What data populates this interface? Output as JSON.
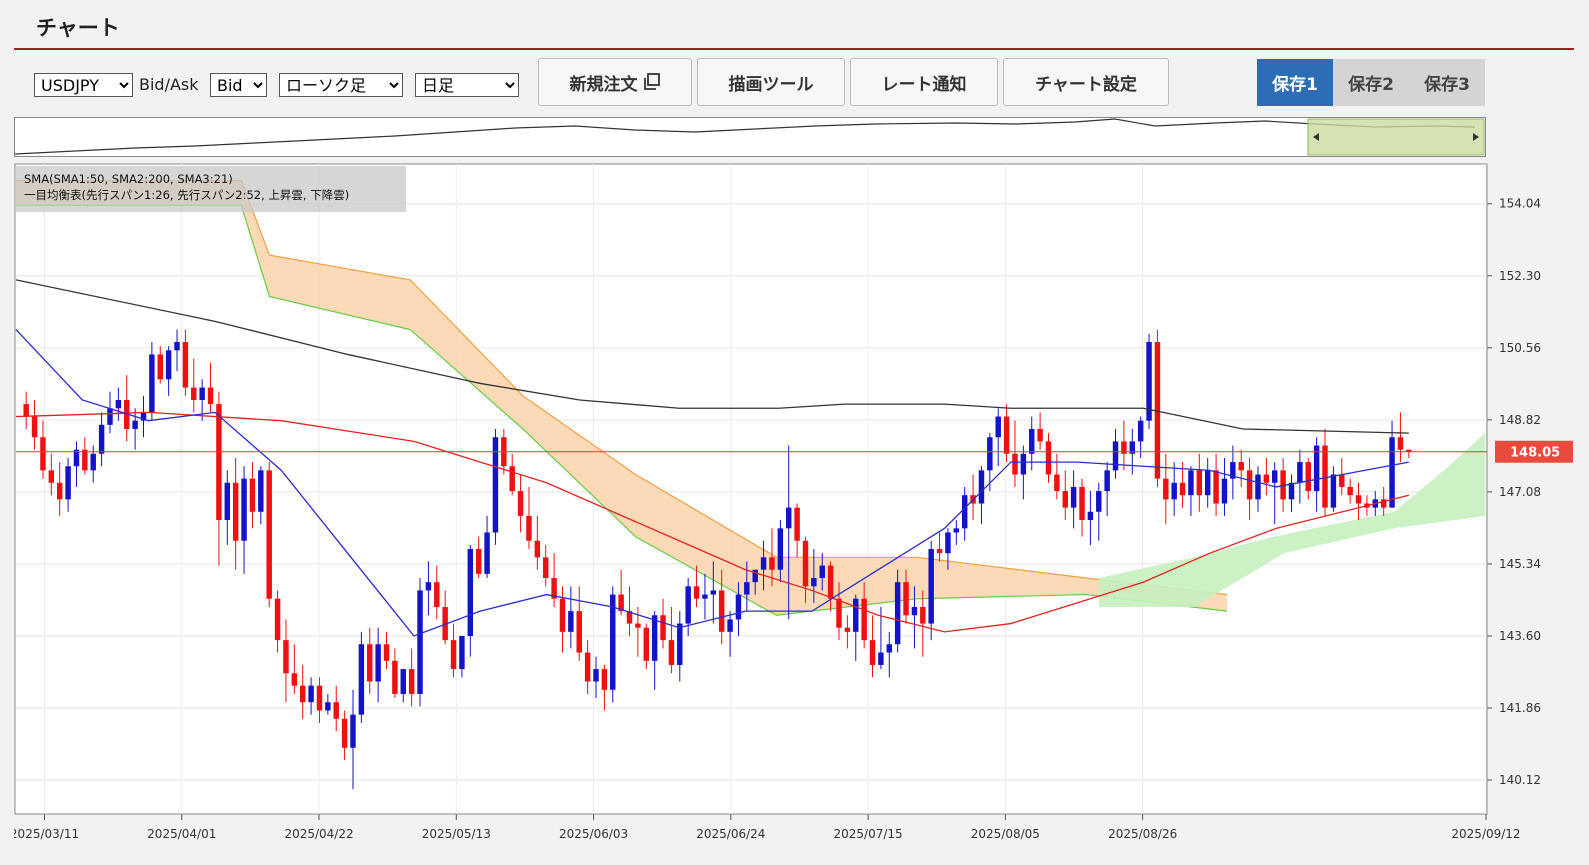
{
  "header": {
    "title": "チャート"
  },
  "toolbar": {
    "symbol": "USDJPY",
    "bidask_label": "Bid/Ask",
    "bidask_value": "Bid",
    "chart_type": "ローソク足",
    "period": "日足",
    "new_order": "新規注文",
    "drawing_tools": "描画ツール",
    "rate_alert": "レート通知",
    "chart_settings": "チャート設定"
  },
  "save": {
    "save1": "保存1",
    "save2": "保存2",
    "save3": "保存3"
  },
  "legend": {
    "sma": "SMA(SMA1:50, SMA2:200, SMA3:21)",
    "ichimoku": "一目均衡表(先行スパン1:26, 先行スパン2:52, 上昇雲, 下降雲)"
  },
  "colors": {
    "up": "#1313c8",
    "down": "#ee1111",
    "sma1": "#e52020",
    "sma2": "#333333",
    "sma3": "#2a2ad0",
    "cloud_bear": "#fbd3ab",
    "cloud_bull": "#c5f0bf",
    "span1": "#66cc44",
    "span2": "#f0a040",
    "accent": "#2d6db5"
  },
  "chart_data": {
    "type": "candlestick",
    "current_price": "148.05",
    "ylim": [
      139.3,
      155.0
    ],
    "y_ticks": [
      "154.04",
      "152.30",
      "150.56",
      "148.82",
      "147.08",
      "145.34",
      "143.60",
      "141.86",
      "140.12"
    ],
    "x_ticks": [
      "2025/03/11",
      "2025/04/01",
      "2025/04/22",
      "2025/05/13",
      "2025/06/03",
      "2025/06/24",
      "2025/07/15",
      "2025/08/05",
      "2025/08/26",
      "2025/09/12"
    ],
    "candles": [
      [
        149.2,
        149.5,
        148.6,
        148.9
      ],
      [
        148.9,
        149.3,
        148.1,
        148.4
      ],
      [
        148.4,
        148.8,
        147.4,
        147.6
      ],
      [
        147.6,
        148.0,
        147.0,
        147.3
      ],
      [
        147.3,
        147.8,
        146.5,
        146.9
      ],
      [
        146.9,
        147.9,
        146.6,
        147.7
      ],
      [
        147.7,
        148.3,
        147.2,
        148.1
      ],
      [
        148.1,
        148.4,
        147.5,
        147.6
      ],
      [
        147.6,
        148.2,
        147.3,
        148.0
      ],
      [
        148.0,
        149.0,
        147.7,
        148.7
      ],
      [
        148.7,
        149.5,
        148.5,
        149.1
      ],
      [
        149.1,
        149.6,
        148.8,
        149.3
      ],
      [
        149.3,
        149.9,
        148.3,
        148.6
      ],
      [
        148.6,
        149.1,
        148.1,
        148.8
      ],
      [
        148.8,
        149.4,
        148.4,
        149.0
      ],
      [
        149.0,
        150.7,
        148.8,
        150.4
      ],
      [
        150.4,
        150.6,
        149.7,
        149.8
      ],
      [
        149.8,
        150.6,
        149.4,
        150.5
      ],
      [
        150.5,
        151.0,
        150.0,
        150.7
      ],
      [
        150.7,
        151.0,
        149.4,
        149.6
      ],
      [
        149.6,
        150.3,
        149.0,
        149.3
      ],
      [
        149.3,
        149.8,
        148.8,
        149.6
      ],
      [
        149.6,
        150.2,
        149.0,
        149.2
      ],
      [
        149.2,
        149.5,
        145.3,
        146.4
      ],
      [
        146.4,
        147.6,
        145.8,
        147.3
      ],
      [
        147.3,
        147.9,
        145.2,
        145.9
      ],
      [
        145.9,
        147.7,
        145.1,
        147.4
      ],
      [
        147.4,
        147.8,
        146.2,
        146.6
      ],
      [
        146.6,
        147.7,
        146.3,
        147.6
      ],
      [
        147.6,
        147.8,
        144.3,
        144.5
      ],
      [
        144.5,
        144.7,
        143.2,
        143.5
      ],
      [
        143.5,
        144.0,
        142.0,
        142.7
      ],
      [
        142.7,
        143.4,
        142.2,
        142.4
      ],
      [
        142.4,
        142.9,
        141.6,
        142.0
      ],
      [
        142.0,
        142.6,
        141.7,
        142.4
      ],
      [
        142.4,
        142.6,
        141.5,
        141.8
      ],
      [
        141.8,
        142.2,
        141.7,
        142.0
      ],
      [
        142.0,
        142.4,
        141.3,
        141.6
      ],
      [
        141.6,
        141.8,
        140.6,
        140.9
      ],
      [
        140.9,
        142.3,
        139.9,
        141.7
      ],
      [
        141.7,
        143.7,
        141.5,
        143.4
      ],
      [
        143.4,
        143.8,
        142.2,
        142.5
      ],
      [
        142.5,
        143.8,
        142.0,
        143.4
      ],
      [
        143.4,
        143.7,
        142.8,
        143.0
      ],
      [
        143.0,
        143.3,
        142.1,
        142.2
      ],
      [
        142.2,
        142.8,
        142.0,
        142.8
      ],
      [
        142.8,
        143.3,
        141.9,
        142.2
      ],
      [
        142.2,
        145.0,
        141.9,
        144.7
      ],
      [
        144.7,
        145.4,
        144.1,
        144.9
      ],
      [
        144.9,
        145.3,
        144.0,
        144.3
      ],
      [
        144.3,
        144.7,
        143.4,
        143.5
      ],
      [
        143.5,
        143.9,
        142.6,
        142.8
      ],
      [
        142.8,
        143.5,
        142.6,
        143.6
      ],
      [
        143.6,
        145.8,
        143.1,
        145.7
      ],
      [
        145.7,
        146.0,
        145.0,
        145.1
      ],
      [
        145.1,
        146.5,
        145.0,
        146.1
      ],
      [
        146.1,
        148.6,
        145.8,
        148.4
      ],
      [
        148.4,
        148.6,
        147.5,
        147.7
      ],
      [
        147.7,
        148.0,
        147.0,
        147.1
      ],
      [
        147.1,
        147.5,
        146.1,
        146.5
      ],
      [
        146.5,
        147.2,
        145.7,
        145.9
      ],
      [
        145.9,
        146.5,
        145.2,
        145.5
      ],
      [
        145.5,
        145.8,
        144.8,
        145.0
      ],
      [
        145.0,
        145.6,
        144.3,
        144.5
      ],
      [
        144.5,
        144.8,
        143.2,
        143.7
      ],
      [
        143.7,
        144.8,
        143.3,
        144.2
      ],
      [
        144.2,
        144.8,
        143.0,
        143.2
      ],
      [
        143.2,
        143.5,
        142.2,
        142.5
      ],
      [
        142.5,
        143.1,
        142.1,
        142.8
      ],
      [
        142.8,
        142.9,
        141.8,
        142.3
      ],
      [
        142.3,
        144.8,
        142.0,
        144.6
      ],
      [
        144.6,
        145.2,
        144.1,
        144.2
      ],
      [
        144.2,
        144.8,
        143.6,
        143.9
      ],
      [
        143.9,
        144.3,
        143.1,
        143.8
      ],
      [
        143.8,
        143.9,
        142.8,
        143.0
      ],
      [
        143.0,
        144.2,
        142.3,
        144.1
      ],
      [
        144.1,
        144.5,
        143.3,
        143.5
      ],
      [
        143.5,
        144.3,
        142.7,
        142.9
      ],
      [
        142.9,
        144.2,
        142.5,
        143.9
      ],
      [
        143.9,
        145.0,
        143.6,
        144.8
      ],
      [
        144.8,
        145.3,
        144.3,
        144.5
      ],
      [
        144.5,
        145.1,
        144.0,
        144.6
      ],
      [
        144.6,
        145.4,
        143.9,
        144.7
      ],
      [
        144.7,
        145.2,
        143.4,
        143.7
      ],
      [
        143.7,
        144.2,
        143.1,
        144.0
      ],
      [
        144.0,
        144.9,
        143.6,
        144.6
      ],
      [
        144.6,
        145.4,
        144.2,
        144.9
      ],
      [
        144.9,
        145.2,
        144.6,
        145.2
      ],
      [
        145.2,
        145.9,
        144.7,
        145.5
      ],
      [
        145.5,
        146.2,
        144.8,
        145.2
      ],
      [
        145.2,
        146.4,
        144.9,
        146.2
      ],
      [
        146.2,
        148.2,
        144.0,
        146.7
      ],
      [
        146.7,
        146.8,
        145.5,
        145.9
      ],
      [
        145.9,
        146.0,
        144.4,
        144.8
      ],
      [
        144.8,
        145.7,
        144.4,
        145.0
      ],
      [
        145.0,
        145.6,
        144.7,
        145.3
      ],
      [
        145.3,
        145.4,
        144.2,
        144.5
      ],
      [
        144.5,
        144.9,
        143.5,
        143.8
      ],
      [
        143.8,
        144.1,
        143.3,
        143.7
      ],
      [
        143.7,
        144.6,
        143.0,
        144.5
      ],
      [
        144.5,
        144.9,
        143.3,
        143.5
      ],
      [
        143.5,
        144.1,
        142.6,
        142.9
      ],
      [
        142.9,
        144.3,
        142.8,
        143.2
      ],
      [
        143.2,
        143.7,
        142.6,
        143.4
      ],
      [
        143.4,
        145.2,
        143.2,
        144.9
      ],
      [
        144.9,
        145.2,
        143.9,
        144.1
      ],
      [
        144.1,
        144.8,
        143.3,
        144.3
      ],
      [
        144.3,
        144.7,
        143.1,
        143.9
      ],
      [
        143.9,
        145.9,
        143.5,
        145.7
      ],
      [
        145.7,
        146.1,
        145.4,
        145.6
      ],
      [
        145.6,
        146.2,
        145.2,
        146.1
      ],
      [
        146.1,
        146.4,
        145.8,
        146.2
      ],
      [
        146.2,
        147.2,
        145.9,
        147.0
      ],
      [
        147.0,
        147.5,
        146.4,
        146.8
      ],
      [
        146.8,
        147.7,
        146.3,
        147.6
      ],
      [
        147.6,
        148.5,
        147.1,
        148.4
      ],
      [
        148.4,
        149.1,
        147.7,
        148.9
      ],
      [
        148.9,
        149.2,
        147.8,
        148.0
      ],
      [
        148.0,
        148.8,
        147.2,
        147.5
      ],
      [
        147.5,
        148.2,
        146.9,
        148.0
      ],
      [
        148.0,
        148.9,
        147.6,
        148.6
      ],
      [
        148.6,
        149.0,
        148.1,
        148.3
      ],
      [
        148.3,
        148.5,
        147.3,
        147.5
      ],
      [
        147.5,
        148.0,
        146.9,
        147.1
      ],
      [
        147.1,
        147.6,
        146.4,
        146.7
      ],
      [
        146.7,
        147.6,
        146.2,
        147.2
      ],
      [
        147.2,
        147.4,
        146.0,
        146.4
      ],
      [
        146.4,
        147.1,
        145.8,
        146.6
      ],
      [
        146.6,
        147.3,
        145.9,
        147.1
      ],
      [
        147.1,
        147.8,
        146.5,
        147.6
      ],
      [
        147.6,
        148.6,
        147.4,
        148.3
      ],
      [
        148.3,
        148.8,
        147.6,
        148.0
      ],
      [
        148.0,
        148.6,
        147.5,
        148.3
      ],
      [
        148.3,
        148.9,
        147.9,
        148.8
      ],
      [
        148.8,
        150.9,
        148.6,
        150.7
      ],
      [
        150.7,
        151.0,
        147.2,
        147.4
      ],
      [
        147.4,
        148.0,
        146.3,
        146.9
      ],
      [
        146.9,
        147.8,
        146.5,
        147.3
      ],
      [
        147.3,
        147.8,
        146.7,
        147.0
      ],
      [
        147.0,
        147.7,
        146.5,
        147.6
      ],
      [
        147.6,
        148.0,
        146.6,
        147.0
      ],
      [
        147.0,
        147.9,
        146.7,
        147.6
      ],
      [
        147.6,
        148.0,
        146.5,
        146.8
      ],
      [
        146.8,
        147.9,
        146.5,
        147.4
      ],
      [
        147.4,
        148.2,
        146.9,
        147.8
      ],
      [
        147.8,
        148.1,
        147.2,
        147.6
      ],
      [
        147.6,
        147.9,
        146.4,
        146.9
      ],
      [
        146.9,
        147.7,
        146.6,
        147.5
      ],
      [
        147.5,
        147.9,
        147.0,
        147.3
      ],
      [
        147.3,
        147.8,
        146.3,
        147.6
      ],
      [
        147.6,
        147.9,
        146.6,
        146.9
      ],
      [
        146.9,
        147.5,
        146.6,
        147.3
      ],
      [
        147.3,
        148.1,
        146.8,
        147.8
      ],
      [
        147.8,
        147.9,
        146.9,
        147.1
      ],
      [
        147.1,
        148.4,
        146.6,
        148.2
      ],
      [
        148.2,
        148.6,
        146.5,
        146.7
      ],
      [
        146.7,
        147.7,
        146.6,
        147.5
      ],
      [
        147.5,
        147.9,
        147.0,
        147.2
      ],
      [
        147.2,
        147.4,
        146.8,
        147.0
      ],
      [
        147.0,
        147.3,
        146.4,
        146.8
      ],
      [
        146.8,
        147.0,
        146.5,
        146.7
      ],
      [
        146.7,
        147.1,
        146.5,
        146.9
      ],
      [
        146.9,
        147.2,
        146.5,
        146.7
      ],
      [
        146.7,
        148.8,
        146.7,
        148.4
      ],
      [
        148.4,
        149.0,
        147.8,
        148.1
      ],
      [
        148.1,
        148.1,
        147.9,
        148.05
      ]
    ],
    "sma1": [
      [
        0,
        148.9
      ],
      [
        20,
        149.0
      ],
      [
        40,
        148.8
      ],
      [
        60,
        148.3
      ],
      [
        80,
        147.3
      ],
      [
        100,
        145.9
      ],
      [
        110,
        145.2
      ],
      [
        120,
        144.7
      ],
      [
        130,
        144.1
      ],
      [
        140,
        143.7
      ],
      [
        150,
        143.9
      ],
      [
        160,
        144.4
      ],
      [
        170,
        144.9
      ],
      [
        180,
        145.6
      ],
      [
        190,
        146.2
      ],
      [
        200,
        146.6
      ],
      [
        210,
        147.0
      ]
    ],
    "sma2": [
      [
        0,
        152.2
      ],
      [
        30,
        151.2
      ],
      [
        50,
        150.4
      ],
      [
        70,
        149.7
      ],
      [
        85,
        149.3
      ],
      [
        100,
        149.1
      ],
      [
        115,
        149.1
      ],
      [
        125,
        149.2
      ],
      [
        140,
        149.2
      ],
      [
        150,
        149.1
      ],
      [
        170,
        149.1
      ],
      [
        185,
        148.6
      ],
      [
        210,
        148.5
      ]
    ],
    "sma3": [
      [
        0,
        151.0
      ],
      [
        10,
        149.3
      ],
      [
        20,
        148.8
      ],
      [
        30,
        149.0
      ],
      [
        40,
        147.6
      ],
      [
        50,
        145.6
      ],
      [
        60,
        143.6
      ],
      [
        70,
        144.2
      ],
      [
        80,
        144.6
      ],
      [
        90,
        144.3
      ],
      [
        100,
        143.8
      ],
      [
        110,
        144.2
      ],
      [
        120,
        144.2
      ],
      [
        130,
        145.2
      ],
      [
        140,
        146.2
      ],
      [
        150,
        147.8
      ],
      [
        160,
        147.8
      ],
      [
        170,
        147.7
      ],
      [
        180,
        147.6
      ],
      [
        190,
        147.2
      ],
      [
        200,
        147.5
      ],
      [
        210,
        147.8
      ]
    ]
  }
}
